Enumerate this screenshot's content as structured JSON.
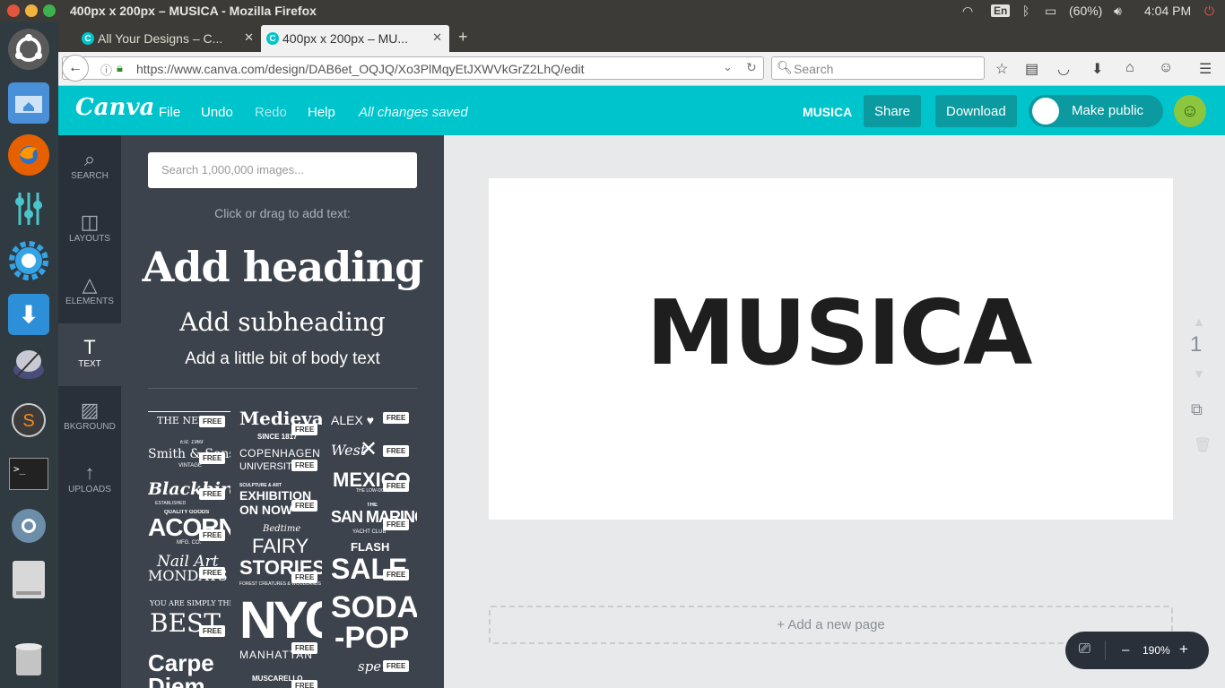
{
  "window": {
    "title": "400px x 200px – MUSICA - Mozilla Firefox"
  },
  "tray": {
    "keyboard": "En",
    "battery": "(60%)",
    "time": "4:04 PM"
  },
  "tabs": [
    {
      "label": "All Your Designs – C..."
    },
    {
      "label": "400px x 200px – MU..."
    }
  ],
  "nav": {
    "url": "https://www.canva.com/design/DAB6et_OQJQ/Xo3PlMqyEtJXWVkGrZ2LhQ/edit",
    "search_placeholder": "Search"
  },
  "canva": {
    "logo": "Canva",
    "menu": {
      "file": "File",
      "undo": "Undo",
      "redo": "Redo",
      "help": "Help"
    },
    "status": "All changes saved",
    "design_name": "MUSICA",
    "share": "Share",
    "download": "Download",
    "make_public": "Make public"
  },
  "sidenav": {
    "search": "SEARCH",
    "layouts": "LAYOUTS",
    "elements": "ELEMENTS",
    "text": "TEXT",
    "background": "BKGROUND",
    "uploads": "UPLOADS"
  },
  "panel": {
    "search_placeholder": "Search 1,000,000 images...",
    "hint": "Click or drag to add text:",
    "add_heading": "Add heading",
    "add_subheading": "Add subheading",
    "add_body": "Add a little bit of body text",
    "free": "FREE",
    "templates": {
      "t1": "THE NEW",
      "t2": "Medieval",
      "t2b": "SINCE 1817",
      "t3": "ALEX ♥",
      "t4": "Smith & Sons",
      "t4b": "Est. 1969",
      "t4c": "VINTAGE",
      "t5": "COPENHAGEN",
      "t5b": "UNIVERSITY",
      "t6": "West",
      "t6b": "✕",
      "t7": "Blackbird",
      "t7b": "ESTABLISHED",
      "t8": "EXHIBITION",
      "t8b": "ON NOW",
      "t8c": "SCULPTURE & ART",
      "t9": "MEXICO",
      "t9b": "THE LOW-DOWN",
      "t10": "ACORN",
      "t10a": "QUALITY GOODS",
      "t10b": "MFG. CO.",
      "t11": "SAN MARINO",
      "t11a": "THE",
      "t11b": "YACHT CLUB",
      "t12": "Nail Art",
      "t12b": "MONDAYS",
      "t13": "Bedtime",
      "t13b": "FAIRY",
      "t13c": "STORIES",
      "t13d": "FOREST CREATURES & WOODLANDS",
      "t14": "FLASH",
      "t14b": "SALE",
      "t15": "YOU ARE SIMPLY THE",
      "t15b": "BEST",
      "t16": "NYC",
      "t16b": "MANHATTAN",
      "t17": "SODA",
      "t17b": "-POP",
      "t18": "Carpe",
      "t18b": "Diem",
      "t19": "MUSCARELLO",
      "t20": "spe"
    }
  },
  "canvas": {
    "text": "MUSICA",
    "page_number": "1",
    "add_page": "+ Add a new page",
    "zoom": "190%",
    "zoom_minus": "–",
    "zoom_plus": "+"
  }
}
